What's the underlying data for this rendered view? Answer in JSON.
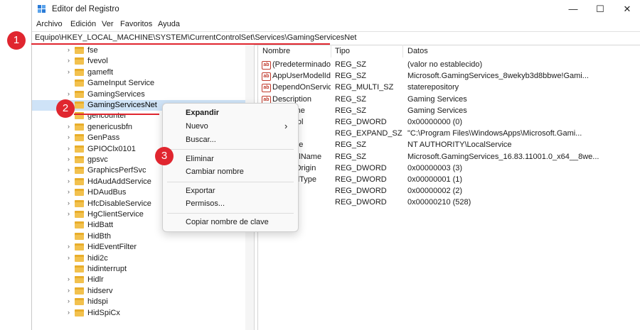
{
  "window": {
    "title": "Editor del Registro",
    "controls": [
      "—",
      "☐",
      "✕"
    ]
  },
  "menu": [
    "Archivo",
    "Edición",
    "Ver",
    "Favoritos",
    "Ayuda"
  ],
  "address": "Equipo\\HKEY_LOCAL_MACHINE\\SYSTEM\\CurrentControlSet\\Services\\GamingServicesNet",
  "tree": [
    {
      "label": "fse",
      "expandable": true
    },
    {
      "label": "fvevol",
      "expandable": true
    },
    {
      "label": "gameflt",
      "expandable": true
    },
    {
      "label": "GameInput Service",
      "expandable": false
    },
    {
      "label": "GamingServices",
      "expandable": true
    },
    {
      "label": "GamingServicesNet",
      "expandable": false,
      "selected": true
    },
    {
      "label": "gencounter",
      "expandable": true
    },
    {
      "label": "genericusbfn",
      "expandable": true
    },
    {
      "label": "GenPass",
      "expandable": true
    },
    {
      "label": "GPIOClx0101",
      "expandable": true
    },
    {
      "label": "gpsvc",
      "expandable": true
    },
    {
      "label": "GraphicsPerfSvc",
      "expandable": true
    },
    {
      "label": "HdAudAddService",
      "expandable": true
    },
    {
      "label": "HDAudBus",
      "expandable": true
    },
    {
      "label": "HfcDisableService",
      "expandable": true
    },
    {
      "label": "HgClientService",
      "expandable": true
    },
    {
      "label": "HidBatt",
      "expandable": false
    },
    {
      "label": "HidBth",
      "expandable": false
    },
    {
      "label": "HidEventFilter",
      "expandable": true
    },
    {
      "label": "hidi2c",
      "expandable": true
    },
    {
      "label": "hidinterrupt",
      "expandable": false
    },
    {
      "label": "Hidlr",
      "expandable": true
    },
    {
      "label": "hidserv",
      "expandable": true
    },
    {
      "label": "hidspi",
      "expandable": true
    },
    {
      "label": "HidSpiCx",
      "expandable": true
    }
  ],
  "columns": {
    "name": "Nombre",
    "type": "Tipo",
    "data": "Datos"
  },
  "values": [
    {
      "name": "(Predeterminado)",
      "type": "REG_SZ",
      "data": "(valor no establecido)"
    },
    {
      "name": "AppUserModelId",
      "type": "REG_SZ",
      "data": "Microsoft.GamingServices_8wekyb3d8bbwe!Gami..."
    },
    {
      "name": "DependOnService",
      "type": "REG_MULTI_SZ",
      "data": "staterepository"
    },
    {
      "name": "Description",
      "type": "REG_SZ",
      "data": "Gaming Services"
    },
    {
      "name": "lame",
      "type": "REG_SZ",
      "data": "Gaming Services"
    },
    {
      "name": "ntrol",
      "type": "REG_DWORD",
      "data": "0x00000000 (0)"
    },
    {
      "name": "th",
      "type": "REG_EXPAND_SZ",
      "data": "\"C:\\Program Files\\WindowsApps\\Microsoft.Gami..."
    },
    {
      "name": "ame",
      "type": "REG_SZ",
      "data": "NT AUTHORITY\\LocalService"
    },
    {
      "name": "FullName",
      "type": "REG_SZ",
      "data": "Microsoft.GamingServices_16.83.11001.0_x64__8we..."
    },
    {
      "name": "Origin",
      "type": "REG_DWORD",
      "data": "0x00000003 (3)"
    },
    {
      "name": "dType",
      "type": "REG_DWORD",
      "data": "0x00000001 (1)"
    },
    {
      "name": "",
      "type": "REG_DWORD",
      "data": "0x00000002 (2)"
    },
    {
      "name": "",
      "type": "REG_DWORD",
      "data": "0x00000210 (528)"
    }
  ],
  "context_menu": {
    "expand": "Expandir",
    "new": "Nuevo",
    "find": "Buscar...",
    "delete": "Eliminar",
    "rename": "Cambiar nombre",
    "export": "Exportar",
    "permissions": "Permisos...",
    "copy_key": "Copiar nombre de clave",
    "submenu_arrow": "›"
  },
  "badges": [
    "1",
    "2",
    "3"
  ],
  "colors": {
    "accent_red": "#e0262f",
    "selection": "#cfe3f7"
  }
}
